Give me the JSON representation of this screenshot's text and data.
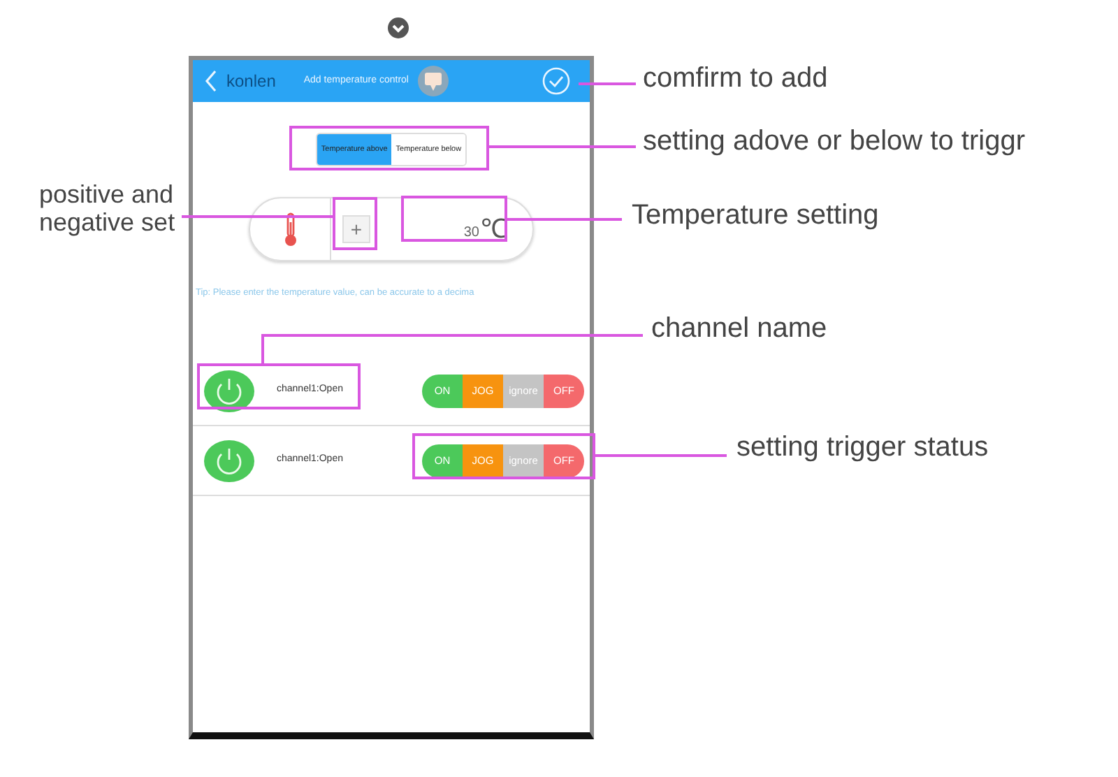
{
  "header": {
    "back_label": "konlen",
    "title": "Add temperature control"
  },
  "trigger_mode": [
    {
      "label": "Temperature above",
      "selected": true
    },
    {
      "label": "Temperature below",
      "selected": false
    }
  ],
  "temperature": {
    "sign": "+",
    "value": "30",
    "unit": "℃"
  },
  "tip": "Tip: Please enter the temperature value, can be accurate to a decima",
  "channels": [
    {
      "name": "channel1:Open",
      "trigger": [
        {
          "label": "ON",
          "color": "#4cc95a"
        },
        {
          "label": "JOG",
          "color": "#f7930f"
        },
        {
          "label": "ignore",
          "color": "#c4c4c4"
        },
        {
          "label": "OFF",
          "color": "#f4696c"
        }
      ]
    },
    {
      "name": "channel1:Open",
      "trigger": [
        {
          "label": "ON",
          "color": "#4cc95a"
        },
        {
          "label": "JOG",
          "color": "#f7930f"
        },
        {
          "label": "ignore",
          "color": "#c4c4c4"
        },
        {
          "label": "OFF",
          "color": "#f4696c"
        }
      ]
    }
  ],
  "annotations": [
    {
      "text": "positive and negative set"
    },
    {
      "text": "comfirm to add"
    },
    {
      "text": "setting adove or below to triggr"
    },
    {
      "text": "Temperature setting"
    },
    {
      "text": "channel name"
    },
    {
      "text": "setting trigger status"
    }
  ]
}
